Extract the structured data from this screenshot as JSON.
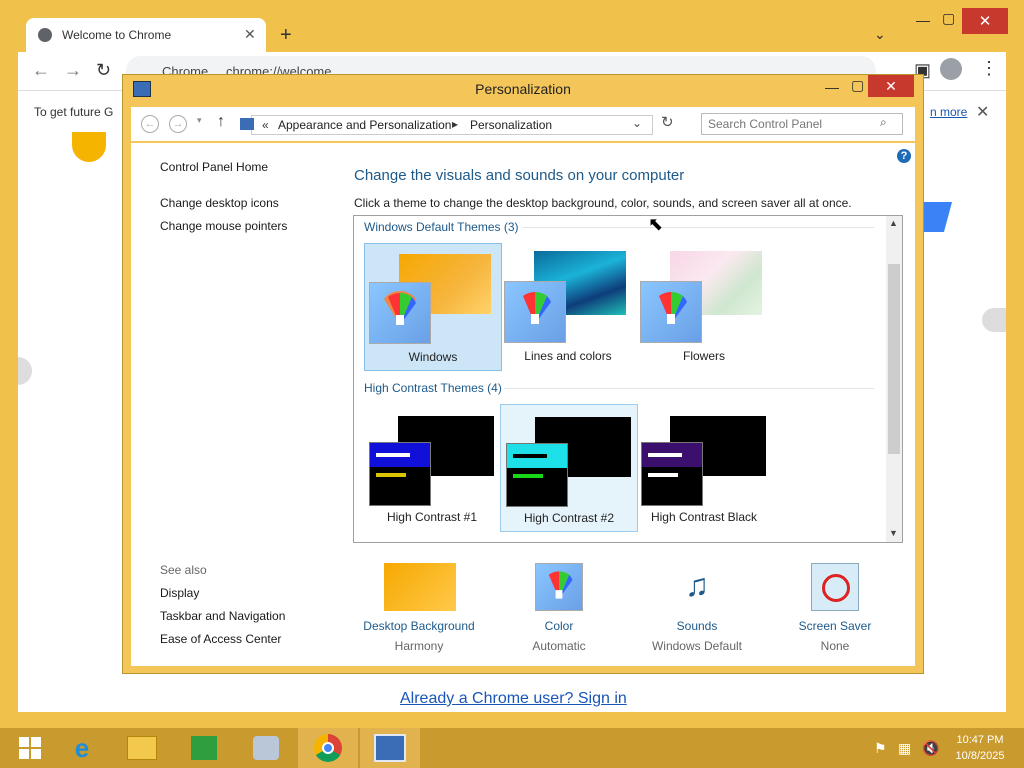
{
  "browser": {
    "tab_title": "Welcome to Chrome",
    "omnibox_site": "Chrome",
    "omnibox_url": "chrome://welcome",
    "infobar_text": "To get future G",
    "infobar_link": "n more",
    "signin_link": "Already a Chrome user? Sign in"
  },
  "window": {
    "title": "Personalization",
    "breadcrumb": [
      "Appearance and Personalization",
      "Personalization"
    ],
    "breadcrumb_prefix": "«",
    "search_placeholder": "Search Control Panel"
  },
  "sidebar": {
    "home": "Control Panel Home",
    "links": [
      "Change desktop icons",
      "Change mouse pointers"
    ],
    "see_also_label": "See also",
    "see_also": [
      "Display",
      "Taskbar and Navigation",
      "Ease of Access Center"
    ]
  },
  "main": {
    "heading": "Change the visuals and sounds on your computer",
    "description": "Click a theme to change the desktop background, color, sounds, and screen saver all at once.",
    "section_default": "Windows Default Themes (3)",
    "section_hc": "High Contrast Themes (4)",
    "default_themes": [
      "Windows",
      "Lines and colors",
      "Flowers"
    ],
    "hc_themes": [
      "High Contrast #1",
      "High Contrast #2",
      "High Contrast Black"
    ]
  },
  "bottom": {
    "items": [
      {
        "label": "Desktop Background",
        "value": "Harmony"
      },
      {
        "label": "Color",
        "value": "Automatic"
      },
      {
        "label": "Sounds",
        "value": "Windows Default"
      },
      {
        "label": "Screen Saver",
        "value": "None"
      }
    ]
  },
  "taskbar": {
    "time": "10:47 PM",
    "date": "10/8/2025"
  },
  "colors": {
    "accent": "#f4c65a",
    "link_blue": "#1e5a8a",
    "close_red": "#c7382d"
  }
}
